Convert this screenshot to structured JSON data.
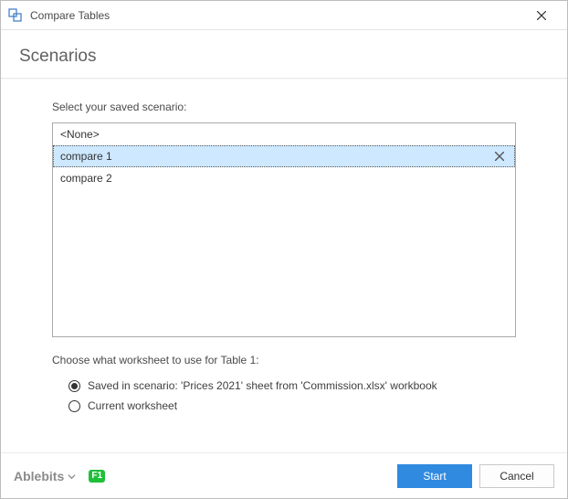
{
  "window": {
    "title": "Compare Tables"
  },
  "header": {
    "title": "Scenarios"
  },
  "main": {
    "list_label": "Select your saved scenario:",
    "items": [
      {
        "label": "<None>",
        "selected": false,
        "deletable": false
      },
      {
        "label": "compare 1",
        "selected": true,
        "deletable": true
      },
      {
        "label": "compare 2",
        "selected": false,
        "deletable": false
      }
    ],
    "worksheet_label": "Choose what worksheet to use for Table 1:",
    "radios": [
      {
        "label": "Saved in scenario: 'Prices 2021' sheet from 'Commission.xlsx' workbook",
        "checked": true
      },
      {
        "label": "Current worksheet",
        "checked": false
      }
    ]
  },
  "footer": {
    "brand": "Ablebits",
    "help": "F1",
    "start": "Start",
    "cancel": "Cancel"
  }
}
